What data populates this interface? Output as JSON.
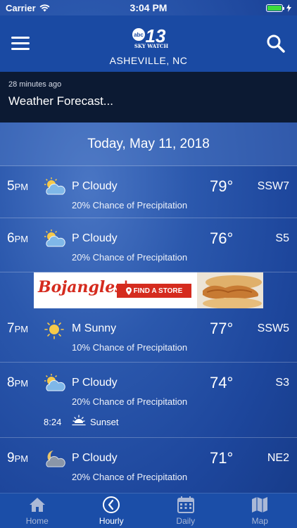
{
  "status_bar": {
    "carrier": "Carrier",
    "time": "3:04 PM"
  },
  "header": {
    "city": "ASHEVILLE, NC",
    "logo_text": "13",
    "logo_sub": "SKY WATCH",
    "logo_abc": "abc"
  },
  "alert": {
    "time_ago": "28 minutes ago",
    "title": "Weather Forecast..."
  },
  "date_label": "Today, May 11, 2018",
  "rows": [
    {
      "hour": "5",
      "ampm": "PM",
      "icon": "partly-cloudy-icon",
      "condition": "P Cloudy",
      "temp": "79°",
      "wind": "SSW7",
      "precip": "20% Chance of Precipitation"
    },
    {
      "hour": "6",
      "ampm": "PM",
      "icon": "partly-cloudy-icon",
      "condition": "P Cloudy",
      "temp": "76°",
      "wind": "S5",
      "precip": "20% Chance of Precipitation"
    },
    {
      "hour": "7",
      "ampm": "PM",
      "icon": "sunny-icon",
      "condition": "M Sunny",
      "temp": "77°",
      "wind": "SSW5",
      "precip": "10% Chance of Precipitation"
    },
    {
      "hour": "8",
      "ampm": "PM",
      "icon": "partly-cloudy-icon",
      "condition": "P Cloudy",
      "temp": "74°",
      "wind": "S3",
      "precip": "20% Chance of Precipitation",
      "sunset_time": "8:24",
      "sunset_label": "Sunset"
    },
    {
      "hour": "9",
      "ampm": "PM",
      "icon": "partly-cloudy-night-icon",
      "condition": "P Cloudy",
      "temp": "71°",
      "wind": "NE2",
      "precip": "20% Chance of Precipitation"
    }
  ],
  "ad": {
    "brand": "Bojangles'",
    "cta": "FIND A STORE"
  },
  "tabs": [
    {
      "label": "Home",
      "icon": "home-icon",
      "active": false
    },
    {
      "label": "Hourly",
      "icon": "clock-icon",
      "active": true
    },
    {
      "label": "Daily",
      "icon": "calendar-icon",
      "active": false
    },
    {
      "label": "Map",
      "icon": "map-icon",
      "active": false
    }
  ],
  "colors": {
    "header": "#1a4aa3",
    "alert_bg": "#0c1a33",
    "ad_red": "#d52b1e",
    "battery": "#3ddc3d"
  }
}
